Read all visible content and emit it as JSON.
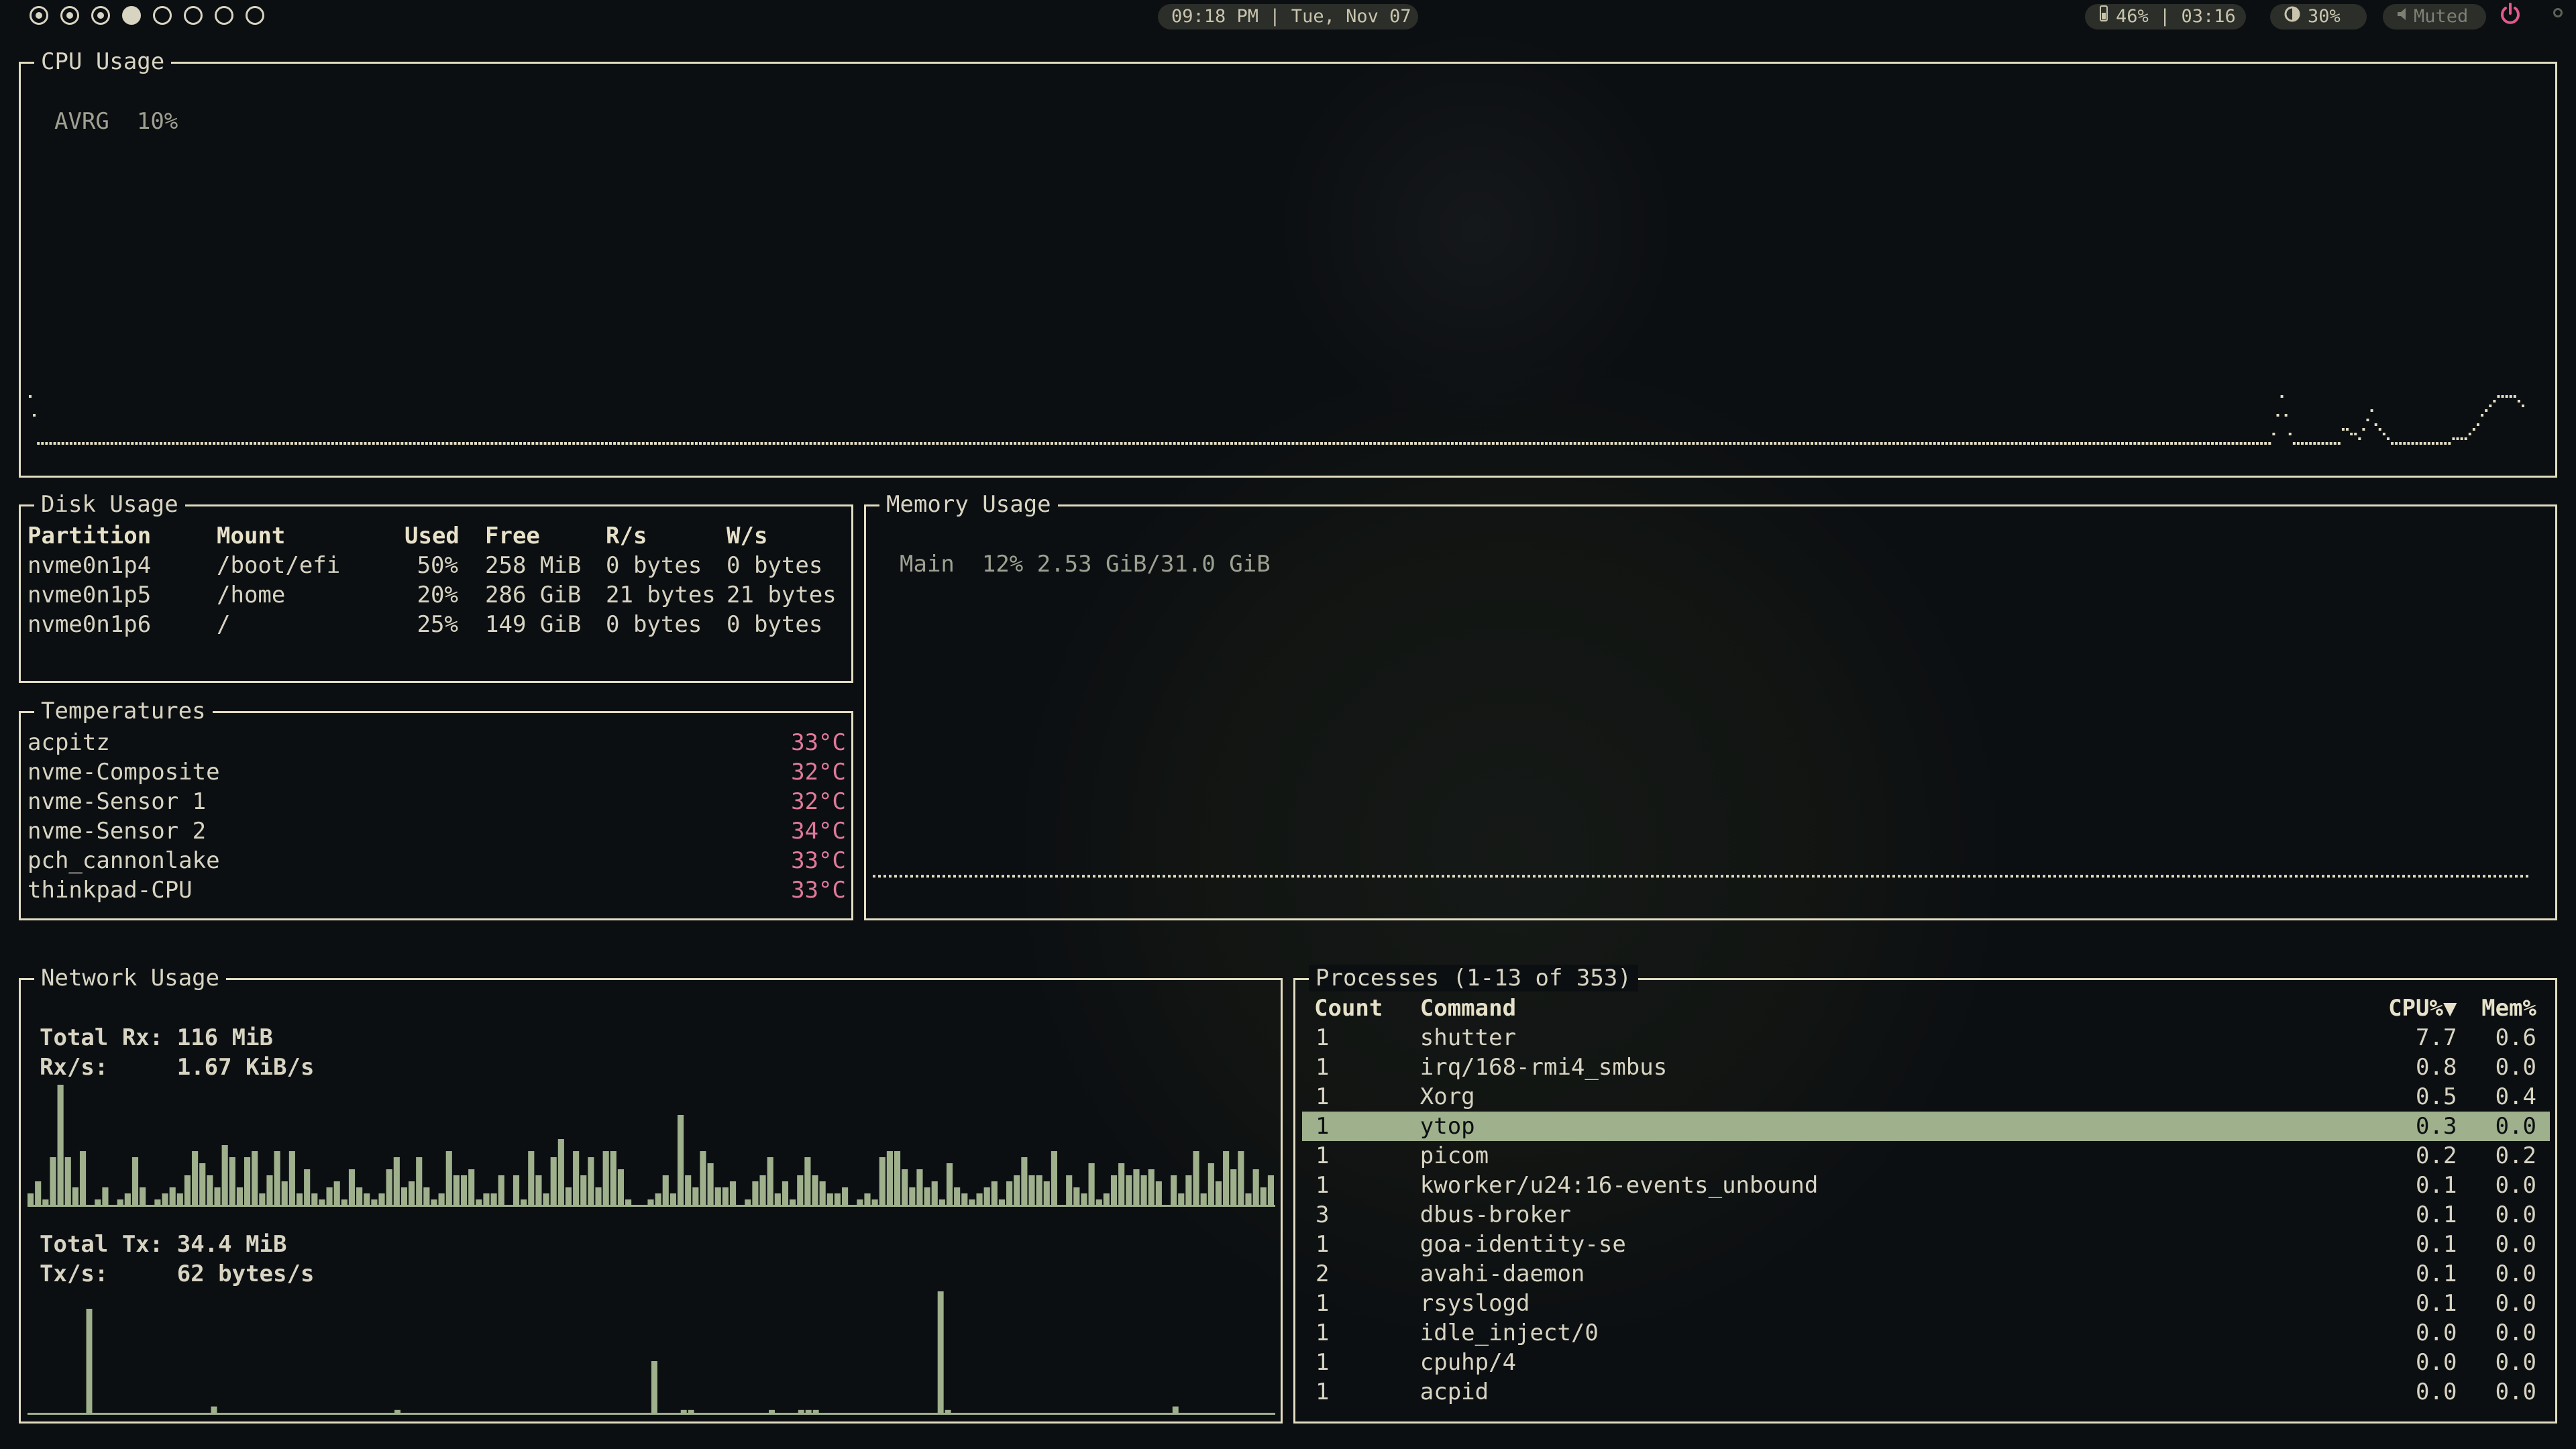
{
  "bar": {
    "workspaces": [
      "visited",
      "visited",
      "visited",
      "active",
      "empty",
      "empty",
      "empty",
      "empty"
    ],
    "clock": "09:18 PM | Tue, Nov 07",
    "battery": "46% | 03:16",
    "battery_icon": "battery-icon",
    "brightness": "30%",
    "brightness_icon": "brightness-icon",
    "volume": "Muted",
    "volume_icon": "speaker-muted-icon",
    "power_icon": "power-icon"
  },
  "cpu": {
    "title": "CPU Usage",
    "avg_label": "AVRG",
    "avg_value": "10%",
    "series": [
      12,
      8,
      2,
      2,
      2,
      2,
      2,
      2,
      2,
      2,
      2,
      2,
      2,
      2,
      2,
      2,
      2,
      2,
      2,
      2,
      2,
      2,
      2,
      2,
      2,
      2,
      2,
      2,
      2,
      2,
      2,
      2,
      2,
      2,
      2,
      2,
      2,
      2,
      2,
      2,
      2,
      2,
      2,
      2,
      2,
      2,
      2,
      2,
      2,
      2,
      2,
      2,
      2,
      2,
      2,
      2,
      2,
      2,
      2,
      2,
      2,
      2,
      2,
      2,
      2,
      2,
      2,
      2,
      2,
      2,
      2,
      2,
      2,
      2,
      2,
      2,
      2,
      2,
      2,
      2,
      2,
      2,
      2,
      2,
      2,
      2,
      2,
      2,
      2,
      2,
      2,
      2,
      2,
      2,
      2,
      2,
      2,
      2,
      2,
      2,
      2,
      2,
      2,
      2,
      2,
      2,
      2,
      2,
      2,
      2,
      2,
      2,
      2,
      2,
      2,
      2,
      2,
      2,
      2,
      2,
      2,
      2,
      2,
      2,
      2,
      2,
      2,
      2,
      2,
      2,
      2,
      2,
      2,
      2,
      2,
      2,
      2,
      2,
      2,
      2,
      2,
      2,
      2,
      2,
      2,
      2,
      2,
      2,
      2,
      2,
      2,
      2,
      2,
      2,
      2,
      2,
      2,
      2,
      2,
      2,
      2,
      2,
      2,
      2,
      2,
      2,
      2,
      2,
      2,
      2,
      2,
      2,
      2,
      2,
      2,
      2,
      2,
      2,
      2,
      2,
      2,
      2,
      2,
      2,
      2,
      2,
      2,
      2,
      2,
      2,
      2,
      2,
      2,
      2,
      2,
      2,
      2,
      2,
      2,
      2,
      2,
      2,
      2,
      2,
      2,
      2,
      2,
      2,
      2,
      2,
      2,
      2,
      2,
      2,
      2,
      2,
      2,
      2,
      2,
      2,
      2,
      2,
      2,
      2,
      2,
      2,
      2,
      2,
      2,
      2,
      2,
      2,
      2,
      2,
      2,
      2,
      2,
      2,
      2,
      2,
      2,
      2,
      2,
      2,
      2,
      2,
      2,
      2,
      2,
      2,
      2,
      2,
      2,
      2,
      2,
      2,
      2,
      2,
      2,
      2,
      2,
      2,
      2,
      2,
      2,
      2,
      2,
      2,
      2,
      2,
      2,
      2,
      2,
      2,
      2,
      2,
      2,
      2,
      2,
      2,
      2,
      2,
      2,
      2,
      2,
      2,
      2,
      2,
      2,
      2,
      2,
      2,
      2,
      2,
      2,
      2,
      2,
      2,
      2,
      2,
      2,
      2,
      2,
      2,
      2,
      2,
      2,
      2,
      2,
      2,
      2,
      2,
      2,
      2,
      2,
      2,
      2,
      2,
      2,
      2,
      2,
      2,
      2,
      2,
      2,
      2,
      2,
      2,
      2,
      2,
      2,
      2,
      2,
      2,
      2,
      2,
      2,
      2,
      2,
      2,
      2,
      2,
      2,
      2,
      2,
      2,
      2,
      2,
      2,
      2,
      2,
      2,
      2,
      2,
      2,
      2,
      2,
      2,
      2,
      2,
      2,
      2,
      2,
      2,
      2,
      2,
      2,
      2,
      2,
      2,
      2,
      2,
      2,
      2,
      2,
      2,
      2,
      2,
      2,
      2,
      2,
      2,
      2,
      2,
      2,
      2,
      2,
      2,
      2,
      2,
      2,
      2,
      2,
      2,
      2,
      2,
      2,
      2,
      2,
      2,
      2,
      2,
      2,
      2,
      2,
      2,
      2,
      2,
      2,
      2,
      2,
      2,
      2,
      2,
      2,
      2,
      2,
      2,
      2,
      2,
      2,
      2,
      2,
      2,
      2,
      2,
      2,
      2,
      2,
      2,
      2,
      2,
      2,
      2,
      2,
      2,
      2,
      2,
      2,
      2,
      2,
      2,
      2,
      2,
      2,
      2,
      2,
      2,
      2,
      2,
      2,
      2,
      2,
      2,
      2,
      2,
      2,
      2,
      2,
      2,
      2,
      2,
      2,
      2,
      2,
      2,
      2,
      2,
      2,
      2,
      2,
      2,
      2,
      2,
      2,
      2,
      2,
      2,
      2,
      2,
      2,
      2,
      2,
      2,
      2,
      2,
      2,
      2,
      2,
      2,
      2,
      2,
      2,
      2,
      2,
      2,
      2,
      2,
      2,
      2,
      2,
      2,
      2,
      2,
      2,
      2,
      2,
      2,
      2,
      2,
      2,
      2,
      2,
      2,
      2,
      2,
      2,
      2,
      2,
      2,
      2,
      2,
      2,
      2,
      2,
      2,
      2,
      2,
      2,
      2,
      2,
      2,
      2,
      2,
      2,
      2,
      2,
      2,
      2,
      2,
      2,
      2,
      2,
      2,
      2,
      2,
      2,
      2,
      2,
      4,
      8,
      12,
      8,
      4,
      2,
      2,
      2,
      2,
      2,
      2,
      2,
      2,
      2,
      2,
      2,
      2,
      5,
      5,
      4,
      4,
      3,
      5,
      7,
      9,
      6,
      5,
      4,
      3,
      2,
      2,
      2,
      2,
      2,
      2,
      2,
      2,
      2,
      2,
      2,
      2,
      2,
      2,
      2,
      3,
      3,
      3,
      3,
      4,
      5,
      6,
      8,
      9,
      10,
      11,
      12,
      12,
      12,
      12,
      12,
      11,
      10
    ]
  },
  "disk": {
    "title": "Disk Usage",
    "headers": [
      "Partition",
      "Mount",
      "Used",
      "Free",
      "R/s",
      "W/s"
    ],
    "rows": [
      [
        "nvme0n1p4",
        "/boot/efi",
        "50%",
        "258 MiB",
        "0 bytes",
        "0 bytes"
      ],
      [
        "nvme0n1p5",
        "/home",
        "20%",
        "286 GiB",
        "21 bytes",
        "21 bytes"
      ],
      [
        "nvme0n1p6",
        "/",
        "25%",
        "149 GiB",
        "0 bytes",
        "0 bytes"
      ]
    ]
  },
  "temps": {
    "title": "Temperatures",
    "rows": [
      [
        "acpitz",
        "33°C"
      ],
      [
        "nvme-Composite",
        "32°C"
      ],
      [
        "nvme-Sensor 1",
        "32°C"
      ],
      [
        "nvme-Sensor 2",
        "34°C"
      ],
      [
        "pch_cannonlake",
        "33°C"
      ],
      [
        "thinkpad-CPU",
        "33°C"
      ]
    ]
  },
  "memory": {
    "title": "Memory Usage",
    "label": "Main",
    "value": "12% 2.53 GiB/31.0 GiB",
    "level": 0.12
  },
  "network": {
    "title": "Network Usage",
    "rx_total_label": "Total Rx:",
    "rx_total": "116 MiB",
    "rx_rate_label": "Rx/s:",
    "rx_rate": "1.67 KiB/s",
    "tx_total_label": "Total Tx:",
    "tx_total": "34.4 MiB",
    "tx_rate_label": "Tx/s:",
    "tx_rate": "62 bytes/s",
    "rx_series": [
      2,
      4,
      1,
      8,
      20,
      8,
      3,
      9,
      0,
      1,
      3,
      0,
      1,
      2,
      8,
      3,
      0,
      1,
      2,
      3,
      2,
      5,
      9,
      7,
      5,
      3,
      10,
      8,
      3,
      8,
      9,
      2,
      5,
      9,
      4,
      9,
      2,
      6,
      2,
      1,
      3,
      4,
      1,
      6,
      3,
      2,
      1,
      2,
      6,
      8,
      3,
      4,
      8,
      3,
      1,
      2,
      9,
      5,
      5,
      6,
      1,
      2,
      2,
      5,
      0,
      5,
      1,
      9,
      5,
      2,
      8,
      11,
      3,
      9,
      5,
      8,
      3,
      9,
      9,
      6,
      1,
      0,
      0,
      1,
      2,
      5,
      2,
      15,
      5,
      3,
      9,
      7,
      3,
      3,
      4,
      0,
      1,
      4,
      5,
      8,
      2,
      4,
      1,
      5,
      8,
      5,
      4,
      2,
      2,
      3,
      0,
      1,
      2,
      1,
      8,
      9,
      9,
      6,
      3,
      6,
      3,
      4,
      1,
      7,
      3,
      2,
      1,
      2,
      3,
      4,
      1,
      4,
      5,
      8,
      5,
      5,
      4,
      9,
      0,
      5,
      3,
      2,
      7,
      1,
      2,
      5,
      7,
      5,
      6,
      5,
      6,
      4,
      0,
      5,
      2,
      5,
      9,
      2,
      7,
      4,
      9,
      6,
      9,
      2,
      6,
      3,
      5
    ],
    "tx_series": [
      0,
      0,
      0,
      0,
      0,
      0,
      0,
      0,
      30,
      0,
      0,
      0,
      0,
      0,
      0,
      0,
      0,
      0,
      0,
      0,
      0,
      0,
      0,
      0,
      0,
      2,
      0,
      0,
      0,
      0,
      0,
      0,
      0,
      0,
      0,
      0,
      0,
      0,
      0,
      0,
      0,
      0,
      0,
      0,
      0,
      0,
      0,
      0,
      0,
      0,
      1,
      0,
      0,
      0,
      0,
      0,
      0,
      0,
      0,
      0,
      0,
      0,
      0,
      0,
      0,
      0,
      0,
      0,
      0,
      0,
      0,
      0,
      0,
      0,
      0,
      0,
      0,
      0,
      0,
      0,
      0,
      0,
      0,
      0,
      0,
      15,
      0,
      0,
      0,
      1,
      1,
      0,
      0,
      0,
      0,
      0,
      0,
      0,
      0,
      0,
      0,
      1,
      0,
      0,
      0,
      1,
      1,
      1,
      0,
      0,
      0,
      0,
      0,
      0,
      0,
      0,
      0,
      0,
      0,
      0,
      0,
      0,
      0,
      0,
      35,
      1,
      0,
      0,
      0,
      0,
      0,
      0,
      0,
      0,
      0,
      0,
      0,
      0,
      0,
      0,
      0,
      0,
      0,
      0,
      0,
      0,
      0,
      0,
      0,
      0,
      0,
      0,
      0,
      0,
      0,
      0,
      2,
      0,
      0,
      0,
      0,
      0,
      0,
      0,
      0,
      0,
      0,
      0,
      0,
      0
    ]
  },
  "processes": {
    "title": "Processes (1-13 of 353)",
    "headers": [
      "Count",
      "Command",
      "CPU%▼",
      "Mem%"
    ],
    "selected_index": 3,
    "rows": [
      [
        "1",
        "shutter",
        "7.7",
        "0.6"
      ],
      [
        "1",
        "irq/168-rmi4_smbus",
        "0.8",
        "0.0"
      ],
      [
        "1",
        "Xorg",
        "0.5",
        "0.4"
      ],
      [
        "1",
        "ytop",
        "0.3",
        "0.0"
      ],
      [
        "1",
        "picom",
        "0.2",
        "0.2"
      ],
      [
        "1",
        "kworker/u24:16-events_unbound",
        "0.1",
        "0.0"
      ],
      [
        "3",
        "dbus-broker",
        "0.1",
        "0.0"
      ],
      [
        "1",
        "goa-identity-se",
        "0.1",
        "0.0"
      ],
      [
        "2",
        "avahi-daemon",
        "0.1",
        "0.0"
      ],
      [
        "1",
        "rsyslogd",
        "0.1",
        "0.0"
      ],
      [
        "1",
        "idle_inject/0",
        "0.0",
        "0.0"
      ],
      [
        "1",
        "cpuhp/4",
        "0.0",
        "0.0"
      ],
      [
        "1",
        "acpid",
        "0.0",
        "0.0"
      ]
    ]
  },
  "colors": {
    "border": "#e3ddc2",
    "accent": "#9fb08c",
    "temp": "#e07a9a",
    "power": "#e05a8a"
  }
}
